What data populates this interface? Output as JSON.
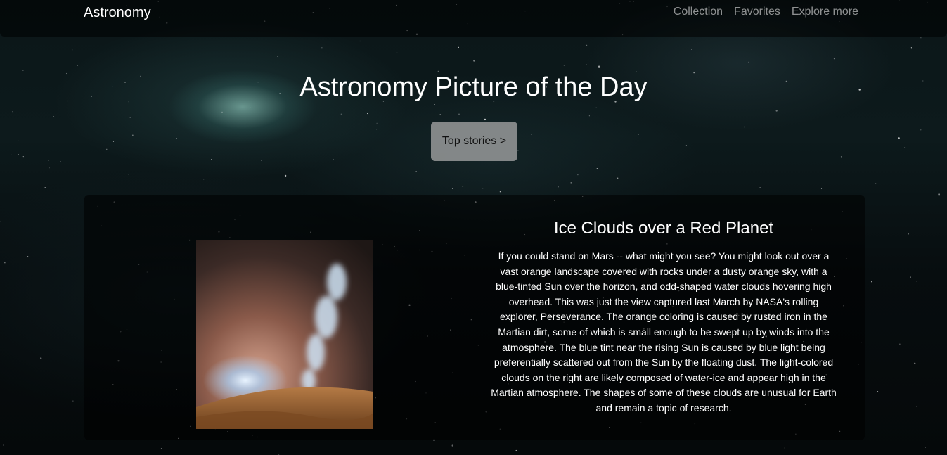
{
  "navbar": {
    "brand": "Astronomy",
    "links": [
      "Collection",
      "Favorites",
      "Explore more"
    ]
  },
  "hero": {
    "title": "Astronomy Picture of the Day",
    "cta_label": "Top stories >"
  },
  "article": {
    "title": "Ice Clouds over a Red Planet",
    "body": "If you could stand on Mars -- what might you see? You might look out over a vast orange landscape covered with rocks under a dusty orange sky, with a blue-tinted Sun over the horizon, and odd-shaped water clouds hovering high overhead. This was just the view captured last March by NASA's rolling explorer, Perseverance. The orange coloring is caused by rusted iron in the Martian dirt, some of which is small enough to be swept up by winds into the atmosphere. The blue tint near the rising Sun is caused by blue light being preferentially scattered out from the Sun by the floating dust. The light-colored clouds on the right are likely composed of water-ice and appear high in the Martian atmosphere. The shapes of some of these clouds are unusual for Earth and remain a topic of research.",
    "image_icon": "mars-sky-photo"
  },
  "colors": {
    "background": "#0b1618",
    "button": "#aaaaaa",
    "nav_link": "#8c8c8c"
  }
}
